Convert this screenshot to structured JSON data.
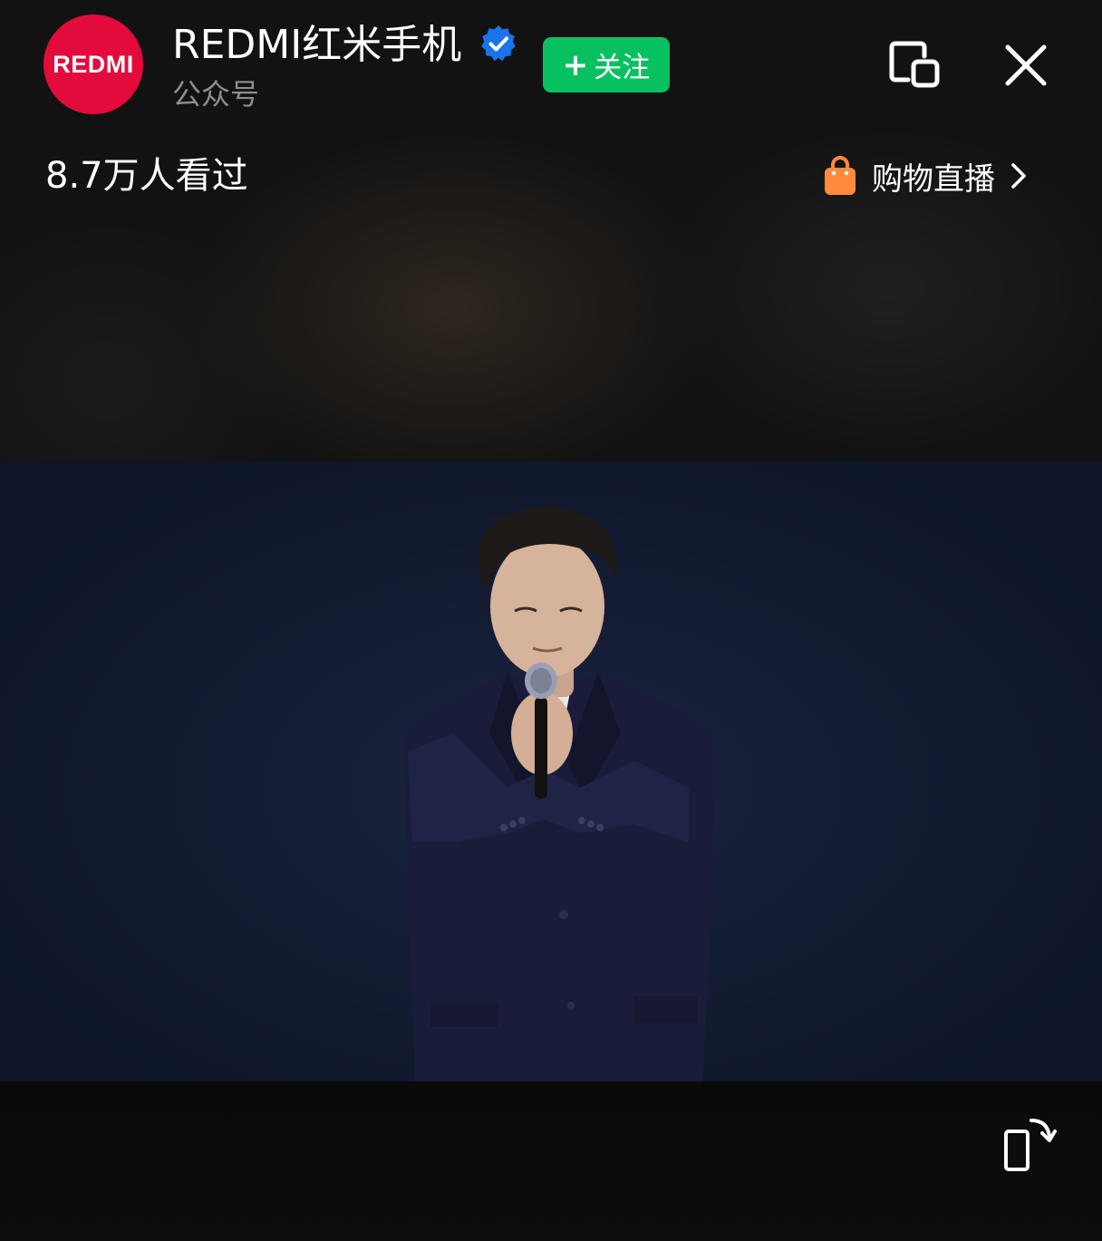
{
  "header": {
    "avatar_text": "REDMI",
    "account_name": "REDMI红米手机",
    "account_type": "公众号",
    "follow_label": "关注",
    "follow_icon": "plus-icon",
    "verified_icon": "verified-badge-icon",
    "float_icon": "floating-window-icon",
    "close_icon": "close-icon"
  },
  "stats": {
    "viewer_count": "8.7万人看过"
  },
  "shop": {
    "label": "购物直播",
    "icon": "shopping-bag-icon",
    "chevron_icon": "chevron-right-icon"
  },
  "controls": {
    "rotate_icon": "rotate-screen-icon"
  },
  "colors": {
    "avatar_bg": "#e30b3c",
    "follow_bg": "#07c160",
    "verified": "#1a73e8",
    "bag": "#ff8a3d",
    "video_bg": "#141c33"
  }
}
